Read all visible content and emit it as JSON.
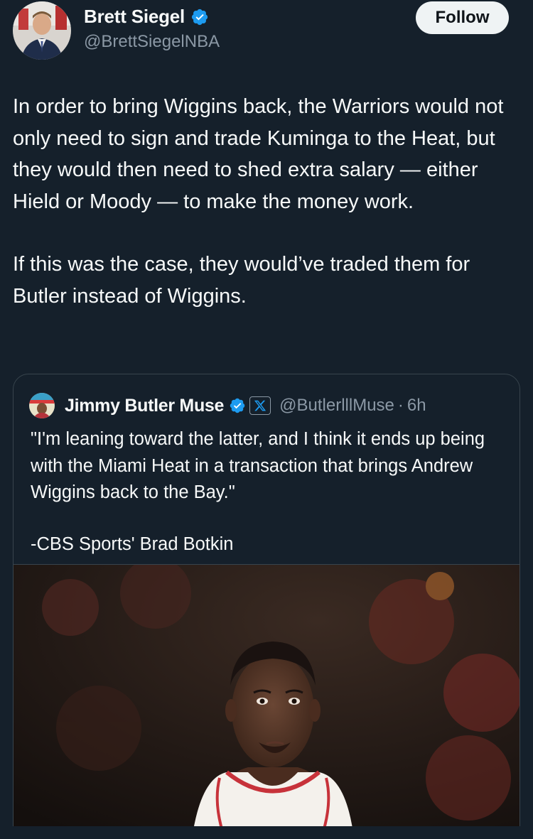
{
  "author": {
    "name": "Brett Siegel",
    "handle": "@BrettSiegelNBA",
    "verified": true
  },
  "follow_label": "Follow",
  "tweet": {
    "paragraphs": [
      "In order to bring Wiggins back, the Warriors would not only need to sign and trade Kuminga to the Heat, but they would then need to shed extra salary — either Hield or Moody — to make the money work.",
      "If this was the case, they would’ve traded them for Butler instead of Wiggins."
    ]
  },
  "quoted": {
    "name": "Jimmy Butler Muse",
    "handle": "@ButlerlllMuse",
    "separator": "·",
    "time": "6h",
    "verified": true,
    "affiliate_icon": "x-logo-icon",
    "paragraphs": [
      "\"I'm leaning toward the latter, and I think it ends up being with the Miami Heat in a transaction that brings Andrew Wiggins back to the Bay.\"",
      "-CBS Sports' Brad Botkin"
    ],
    "media": "basketball-player-photo"
  },
  "colors": {
    "background": "#15202b",
    "text": "#f7f9f9",
    "secondary": "#8b98a5",
    "verified": "#1d9bf0",
    "border": "#38444d"
  }
}
